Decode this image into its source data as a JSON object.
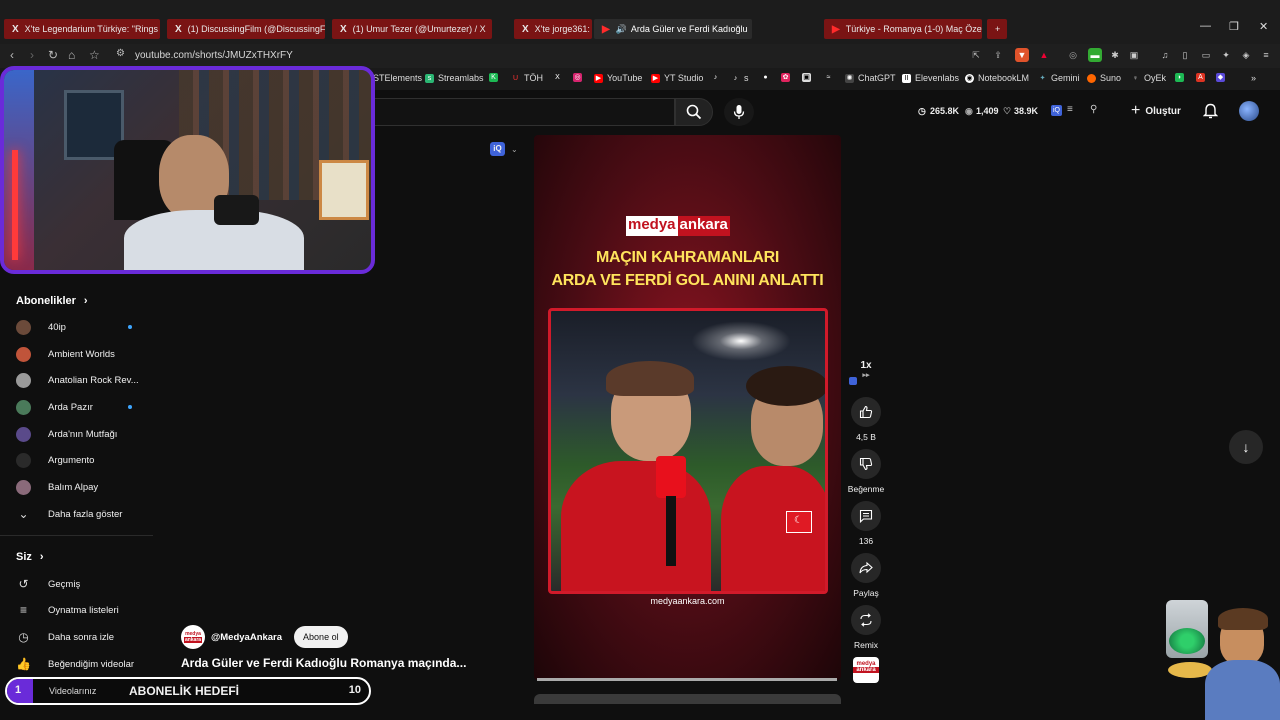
{
  "browser": {
    "tabs": [
      {
        "label": "X'te Legendarium Türkiye: \"Rings of",
        "icon": "x-icon"
      },
      {
        "label": "(1) DiscussingFilm (@DiscussingFilm)",
        "icon": "x-icon"
      },
      {
        "label": "(1) Umur Tezer (@Umurtezer) / X",
        "icon": "x-icon"
      },
      {
        "label": "X'te jorge361: \"",
        "icon": "x-icon"
      },
      {
        "label": "Arda Güler ve Ferdi Kadıoğlu",
        "icon": "youtube-icon"
      },
      {
        "label": "Türkiye - Romanya (1-0) Maç Özeti |",
        "icon": "youtube-icon"
      }
    ],
    "url": "youtube.com/shorts/JMUZxTHXrFY",
    "bookmarks": [
      "STElements",
      "Streamlabs",
      "TÖH",
      "YouTube",
      "YT Studio",
      "s",
      "ChatGPT",
      "Elevenlabs",
      "NotebookLM",
      "Gemini",
      "Suno",
      "OyEk"
    ]
  },
  "header": {
    "stats": [
      "265.8K",
      "1,409",
      "38.9K"
    ],
    "create_label": "Oluştur"
  },
  "sidebar": {
    "subs_title": "Abonelikler",
    "subscriptions": [
      {
        "name": "40ip",
        "dot": true,
        "color": "#6b4a3a"
      },
      {
        "name": "Ambient Worlds",
        "dot": false,
        "color": "#c0543a"
      },
      {
        "name": "Anatolian Rock Rev...",
        "dot": false,
        "color": "#9a9a9a"
      },
      {
        "name": "Arda Pazır",
        "dot": true,
        "color": "#4a7a5a"
      },
      {
        "name": "Arda'nın Mutfağı",
        "dot": false,
        "color": "#5a4a8a"
      },
      {
        "name": "Argumento",
        "dot": false,
        "color": "#2a2a2a"
      },
      {
        "name": "Balım Alpay",
        "dot": false,
        "color": "#8a6a7a"
      }
    ],
    "show_more": "Daha fazla göster",
    "you_title": "Siz",
    "you_items": [
      {
        "label": "Geçmiş",
        "icon": "history-icon"
      },
      {
        "label": "Oynatma listeleri",
        "icon": "playlist-icon"
      },
      {
        "label": "Daha sonra izle",
        "icon": "clock-icon"
      },
      {
        "label": "Beğendiğim videolar",
        "icon": "thumbs-up-icon"
      },
      {
        "label": "Videolarınız",
        "icon": "video-icon"
      }
    ]
  },
  "video": {
    "logo_left": "medya",
    "logo_right": "ankara",
    "headline_1": "MAÇIN KAHRAMANLARI",
    "headline_2": "ARDA VE FERDİ GOL ANINI ANLATTI",
    "frame_url": "medyaankara.com",
    "channel": "@MedyaAnkara",
    "subscribe": "Abone ol",
    "title": "Arda Güler ve Ferdi Kadıoğlu Romanya maçında..."
  },
  "actions": {
    "speed": "1x",
    "likes": "4,5 B",
    "dislike": "Beğenme",
    "comments": "136",
    "share": "Paylaş",
    "remix": "Remix"
  },
  "goal": {
    "number": "1",
    "label": "ABONELİK HEDEFİ",
    "target": "10"
  }
}
